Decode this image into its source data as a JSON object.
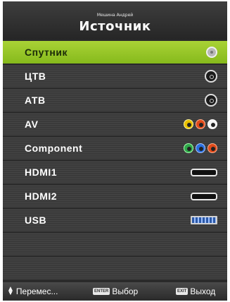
{
  "header": {
    "brand": "Мешина Андрей",
    "title": "Источник"
  },
  "sources": [
    {
      "label": "Спутник",
      "icon": "gray-rf-jack-icon",
      "selected": true
    },
    {
      "label": "ЦТВ",
      "icon": "rf-jack-icon",
      "selected": false
    },
    {
      "label": "АТВ",
      "icon": "rf-jack-icon",
      "selected": false
    },
    {
      "label": "AV",
      "icon": "rca-av-jacks-icon",
      "selected": false
    },
    {
      "label": "Component",
      "icon": "rca-component-jacks-icon",
      "selected": false
    },
    {
      "label": "HDMI1",
      "icon": "hdmi-port-icon",
      "selected": false
    },
    {
      "label": "HDMI2",
      "icon": "hdmi-port-icon",
      "selected": false
    },
    {
      "label": "USB",
      "icon": "usb-port-icon",
      "selected": false
    }
  ],
  "footer": {
    "move_label": "Перемес...",
    "enter_key": "ENTER",
    "select_label": "Выбор",
    "exit_key": "EXIT",
    "exit_label": "Выход"
  },
  "colors": {
    "selected_row": "#9cc72b",
    "row_background": "#3c3c3c",
    "header_background": "#333333"
  }
}
